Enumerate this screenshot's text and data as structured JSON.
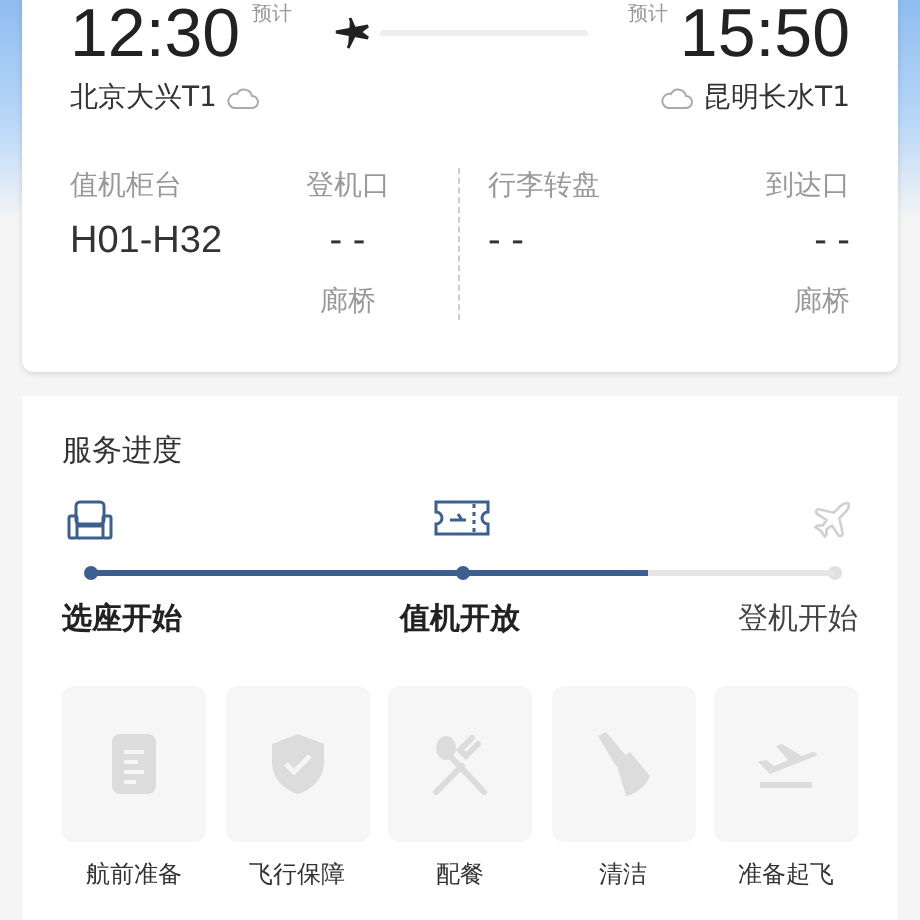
{
  "flight": {
    "departure": {
      "time": "12:30",
      "note": "预计",
      "airport": "北京大兴T1"
    },
    "arrival": {
      "time": "15:50",
      "note": "预计",
      "airport": "昆明长水T1"
    }
  },
  "info": [
    {
      "label": "值机柜台",
      "value": "H01-H32"
    },
    {
      "label": "登机口",
      "value": "- -",
      "sub": "廊桥"
    },
    {
      "label": "行李转盘",
      "value": "- -"
    },
    {
      "label": "到达口",
      "value": "- -",
      "sub": "廊桥"
    }
  ],
  "progress": {
    "title": "服务进度",
    "level": 0.75,
    "steps": [
      {
        "label": "选座开始",
        "reached": true
      },
      {
        "label": "值机开放",
        "reached": true
      },
      {
        "label": "登机开始",
        "reached": false
      }
    ]
  },
  "services": [
    {
      "label": "航前准备"
    },
    {
      "label": "飞行保障"
    },
    {
      "label": "配餐"
    },
    {
      "label": "清洁"
    },
    {
      "label": "准备起飞"
    }
  ]
}
